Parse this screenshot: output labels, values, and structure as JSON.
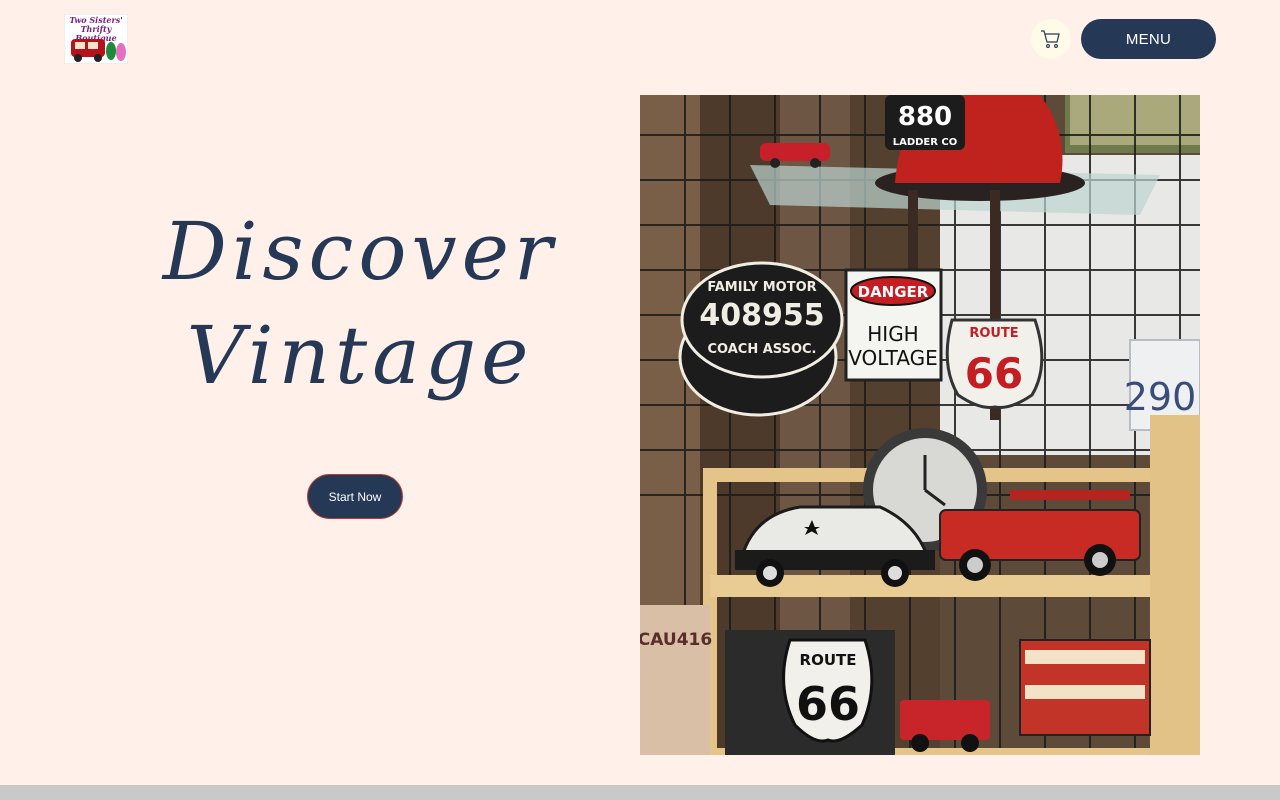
{
  "header": {
    "logo": {
      "line1": "Two Sisters'",
      "line2": "Thrifty Boutique"
    },
    "cart_icon": "cart-icon",
    "menu_label": "MENU"
  },
  "hero": {
    "title_line1": "Discover",
    "title_line2": "Vintage",
    "cta_label": "Start Now"
  },
  "image": {
    "description_icon": "vintage-display-photo",
    "sign_family_motor_line1": "FAMILY MOTOR",
    "sign_family_motor_number": "408955",
    "sign_family_motor_line2": "COACH ASSOC.",
    "sign_danger": "DANGER",
    "sign_high": "HIGH",
    "sign_voltage": "VOLTAGE",
    "sign_route": "ROUTE",
    "sign_66": "66",
    "helmet_number": "880",
    "helmet_label": "LADDER CO",
    "plate_text": "CAU416",
    "plate_number": "290",
    "puzzle_route": "ROUTE",
    "puzzle_66": "66"
  },
  "colors": {
    "background": "#fff1ea",
    "navy": "#253856",
    "footer": "#c9c9c9"
  }
}
